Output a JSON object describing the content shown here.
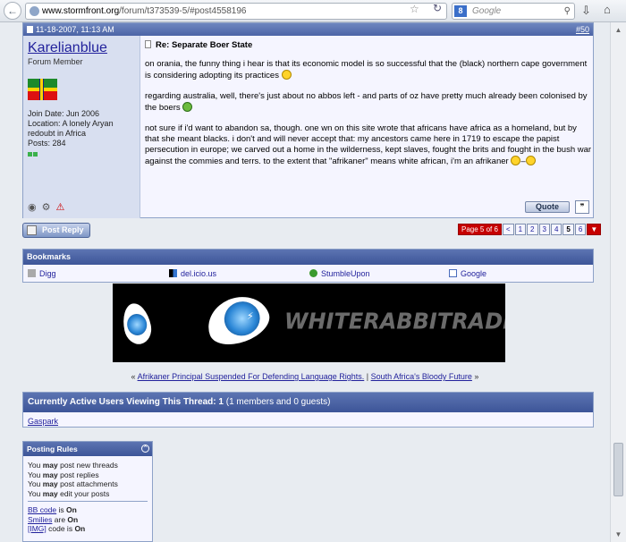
{
  "browser": {
    "url_host": "www.stormfront.org",
    "url_path": "/forum/t373539-5/#post4558196",
    "search_placeholder": "Google",
    "search_engine_letter": "8"
  },
  "post": {
    "date": "11-18-2007, 11:13 AM",
    "number": "#50",
    "username": "Karelianblue",
    "user_title": "Forum Member",
    "join_date": "Join Date: Jun 2006",
    "location": "Location: A lonely Aryan redoubt in Africa",
    "posts": "Posts: 284",
    "title": "Re: Separate Boer State",
    "paragraphs": [
      "on orania, the funny thing i hear is that its economic model is so successful that the (black) northern cape government is considering adopting its practices",
      "regarding australia, well, there's just about no abbos left - and parts of oz have pretty much already been colonised by the boers",
      "not sure if i'd want to abandon sa, though. one wn on this site wrote that africans have africa as a homeland, but by that she meant blacks. i don't and will never accept that: my ancestors came here in 1719 to escape the papist persecution in europe; we carved out a home in the wilderness, kept slaves, fought the brits and fought in the bush war against the commies and terrs. to the extent that \"afrikaner\" means white african, i'm an afrikaner"
    ],
    "quote_label": "Quote"
  },
  "post_reply_label": "Post Reply",
  "pagination": {
    "page_of": "Page 5 of 6",
    "prev": "<",
    "pages": [
      "1",
      "2",
      "3",
      "4",
      "5",
      "6"
    ],
    "current": "5",
    "next": ">"
  },
  "bookmarks": {
    "title": "Bookmarks",
    "items": [
      {
        "label": "Digg",
        "icon": "digg-icon"
      },
      {
        "label": "del.icio.us",
        "icon": "delicious-icon"
      },
      {
        "label": "StumbleUpon",
        "icon": "stumbleupon-icon"
      },
      {
        "label": "Google",
        "icon": "google-icon"
      }
    ]
  },
  "banner": {
    "text": "WHITERABBITRADIO.NET"
  },
  "thread_nav": {
    "prev_marker": "«",
    "prev_thread": "Afrikaner Principal Suspended For Defending Language Rights.",
    "separator": "|",
    "next_thread": "South Africa's Bloody Future",
    "next_marker": "»"
  },
  "active_users": {
    "title_prefix": "Currently Active Users Viewing This Thread: 1",
    "title_suffix": "(1 members and 0 guests)",
    "users": [
      "Gaspark"
    ]
  },
  "posting_rules": {
    "title": "Posting Rules",
    "rules": [
      {
        "pre": "You ",
        "em": "may",
        "post": " post new threads"
      },
      {
        "pre": "You ",
        "em": "may",
        "post": " post replies"
      },
      {
        "pre": "You ",
        "em": "may",
        "post": " post attachments"
      },
      {
        "pre": "You ",
        "em": "may",
        "post": " edit your posts"
      }
    ],
    "codes": [
      {
        "link": "BB code",
        "mid": " is ",
        "state": "On"
      },
      {
        "link": "Smilies",
        "mid": " are ",
        "state": "On"
      },
      {
        "link": "[IMG]",
        "mid": " code is ",
        "state": "On"
      }
    ]
  }
}
